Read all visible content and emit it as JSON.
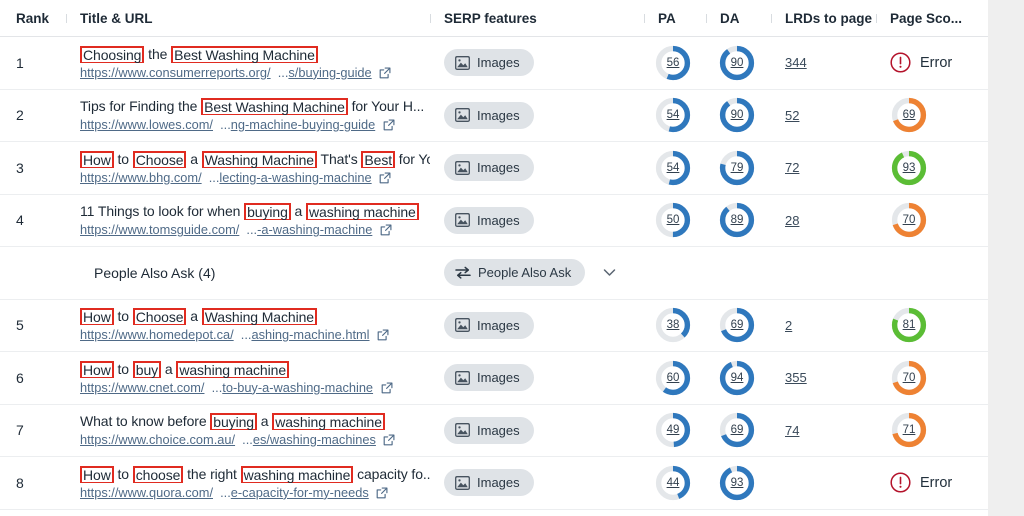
{
  "columns": {
    "rank": "Rank",
    "title_url": "Title & URL",
    "serp_features": "SERP features",
    "pa": "PA",
    "da": "DA",
    "lrds": "LRDs to page",
    "page_score": "Page Sco..."
  },
  "icons": {
    "images": "image-icon",
    "people_also_ask": "swap-arrows-icon",
    "external_link": "external-link-icon",
    "chevron_down": "chevron-down-icon",
    "error": "error-circle-icon"
  },
  "colors": {
    "highlight_border": "#e02b20",
    "pill_bg": "#dfe3e7",
    "donut_blue": "#2f78bd",
    "donut_track": "#e4e7ea",
    "donut_green": "#5bbd35",
    "donut_orange": "#ee8233",
    "error_red": "#b4132b",
    "link": "#4f6a87"
  },
  "serp_pills": {
    "images": "Images",
    "people_also_ask": "People Also Ask"
  },
  "error_label": "Error",
  "rows": [
    {
      "rank": "1",
      "title_parts": [
        {
          "t": "Choosing",
          "hl": true
        },
        {
          "t": " the ",
          "hl": false
        },
        {
          "t": "Best Washing Machine",
          "hl": true
        }
      ],
      "url_domain": "https://www.consumerreports.org/",
      "url_path": "...s/buying-guide",
      "serp": "Images",
      "pa": "56",
      "da": "90",
      "lrds": "344",
      "page_score": null,
      "page_score_error": "Error",
      "score_color": null
    },
    {
      "rank": "2",
      "title_parts": [
        {
          "t": "Tips for Finding the ",
          "hl": false
        },
        {
          "t": "Best Washing Machine",
          "hl": true
        },
        {
          "t": " for Your H...",
          "hl": false
        }
      ],
      "url_domain": "https://www.lowes.com/",
      "url_path": "...ng-machine-buying-guide",
      "serp": "Images",
      "pa": "54",
      "da": "90",
      "lrds": "52",
      "page_score": "69",
      "page_score_error": null,
      "score_color": "orange"
    },
    {
      "rank": "3",
      "title_parts": [
        {
          "t": "How",
          "hl": true
        },
        {
          "t": " to ",
          "hl": false
        },
        {
          "t": "Choose",
          "hl": true
        },
        {
          "t": " a ",
          "hl": false
        },
        {
          "t": "Washing Machine",
          "hl": true
        },
        {
          "t": " That's ",
          "hl": false
        },
        {
          "t": "Best",
          "hl": true
        },
        {
          "t": " for Yo...",
          "hl": false
        }
      ],
      "url_domain": "https://www.bhg.com/",
      "url_path": "...lecting-a-washing-machine",
      "serp": "Images",
      "pa": "54",
      "da": "79",
      "lrds": "72",
      "page_score": "93",
      "page_score_error": null,
      "score_color": "green"
    },
    {
      "rank": "4",
      "title_parts": [
        {
          "t": "11 Things to look for when ",
          "hl": false
        },
        {
          "t": "buying",
          "hl": true
        },
        {
          "t": " a ",
          "hl": false
        },
        {
          "t": "washing machine",
          "hl": true
        }
      ],
      "url_domain": "https://www.tomsguide.com/",
      "url_path": "...-a-washing-machine",
      "serp": "Images",
      "pa": "50",
      "da": "89",
      "lrds": "28",
      "page_score": "70",
      "page_score_error": null,
      "score_color": "orange"
    },
    {
      "rank": "",
      "is_paa": true,
      "paa_label": "People Also Ask (4)",
      "serp": "People Also Ask"
    },
    {
      "rank": "5",
      "title_parts": [
        {
          "t": "How",
          "hl": true
        },
        {
          "t": " to ",
          "hl": false
        },
        {
          "t": "Choose",
          "hl": true
        },
        {
          "t": " a ",
          "hl": false
        },
        {
          "t": "Washing Machine",
          "hl": true
        }
      ],
      "url_domain": "https://www.homedepot.ca/",
      "url_path": "...ashing-machine.html",
      "serp": "Images",
      "pa": "38",
      "da": "69",
      "lrds": "2",
      "page_score": "81",
      "page_score_error": null,
      "score_color": "green"
    },
    {
      "rank": "6",
      "title_parts": [
        {
          "t": "How",
          "hl": true
        },
        {
          "t": " to ",
          "hl": false
        },
        {
          "t": "buy",
          "hl": true
        },
        {
          "t": " a ",
          "hl": false
        },
        {
          "t": "washing machine",
          "hl": true
        }
      ],
      "url_domain": "https://www.cnet.com/",
      "url_path": "...to-buy-a-washing-machine",
      "serp": "Images",
      "pa": "60",
      "da": "94",
      "lrds": "355",
      "page_score": "70",
      "page_score_error": null,
      "score_color": "orange"
    },
    {
      "rank": "7",
      "title_parts": [
        {
          "t": "What to know before ",
          "hl": false
        },
        {
          "t": "buying",
          "hl": true
        },
        {
          "t": " a ",
          "hl": false
        },
        {
          "t": "washing machine",
          "hl": true
        }
      ],
      "url_domain": "https://www.choice.com.au/",
      "url_path": "...es/washing-machines",
      "serp": "Images",
      "pa": "49",
      "da": "69",
      "lrds": "74",
      "page_score": "71",
      "page_score_error": null,
      "score_color": "orange"
    },
    {
      "rank": "8",
      "title_parts": [
        {
          "t": "How",
          "hl": true
        },
        {
          "t": " to ",
          "hl": false
        },
        {
          "t": "choose",
          "hl": true
        },
        {
          "t": " the right ",
          "hl": false
        },
        {
          "t": "washing machine",
          "hl": true
        },
        {
          "t": " capacity fo...",
          "hl": false
        }
      ],
      "url_domain": "https://www.quora.com/",
      "url_path": "...e-capacity-for-my-needs",
      "serp": "Images",
      "pa": "44",
      "da": "93",
      "lrds": "",
      "page_score": null,
      "page_score_error": "Error",
      "score_color": null
    }
  ]
}
